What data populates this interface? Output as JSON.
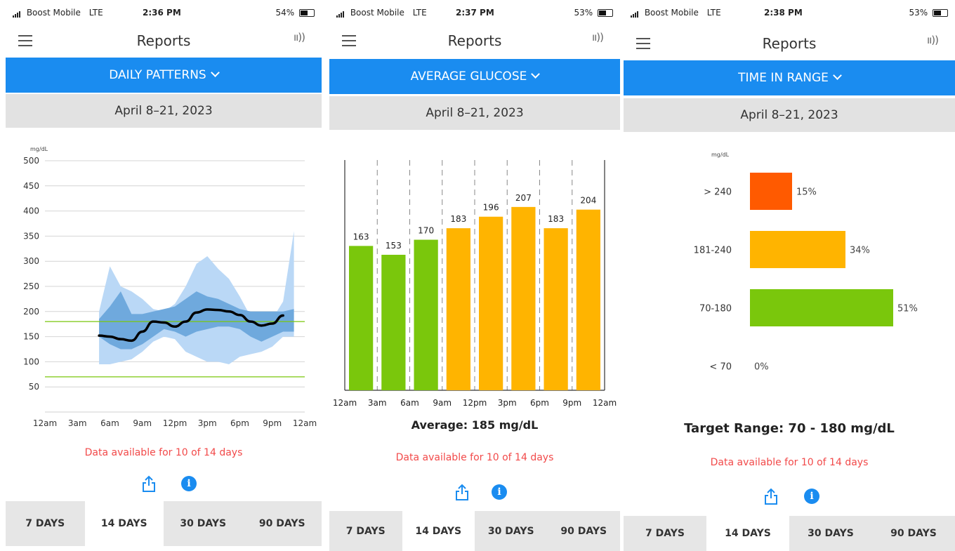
{
  "colors": {
    "accent": "#1a8cf0",
    "warning_text": "#f24a4a",
    "green": "#7ac70c",
    "orange": "#ffb400",
    "red": "#ff5a00"
  },
  "panels": [
    {
      "status": {
        "carrier": "Boost Mobile",
        "network": "LTE",
        "time": "2:36 PM",
        "battery": "54%"
      },
      "title": "Reports",
      "report_type": "DAILY PATTERNS",
      "date_range": "April 8–21, 2023",
      "note": "Data available for 10 of 14 days",
      "tabs": [
        "7 DAYS",
        "14 DAYS",
        "30 DAYS",
        "90 DAYS"
      ],
      "active_tab": 1
    },
    {
      "status": {
        "carrier": "Boost Mobile",
        "network": "LTE",
        "time": "2:37 PM",
        "battery": "53%"
      },
      "title": "Reports",
      "report_type": "AVERAGE GLUCOSE",
      "date_range": "April 8–21, 2023",
      "average": "Average: 185 mg/dL",
      "note": "Data available for 10 of 14 days",
      "tabs": [
        "7 DAYS",
        "14 DAYS",
        "30 DAYS",
        "90 DAYS"
      ],
      "active_tab": 1
    },
    {
      "status": {
        "carrier": "Boost Mobile",
        "network": "LTE",
        "time": "2:38 PM",
        "battery": "53%"
      },
      "title": "Reports",
      "report_type": "TIME IN RANGE",
      "date_range": "April 8–21, 2023",
      "target": "Target Range: 70 - 180 mg/dL",
      "note": "Data available for 10 of 14 days",
      "tabs": [
        "7 DAYS",
        "14 DAYS",
        "30 DAYS",
        "90 DAYS"
      ],
      "active_tab": 1
    }
  ],
  "chart_data": [
    {
      "type": "area",
      "ylabel": "mg/dL",
      "ylim": [
        0,
        500
      ],
      "yticks": [
        50,
        100,
        150,
        200,
        250,
        300,
        350,
        400,
        450,
        500
      ],
      "xticks": [
        "12am",
        "3am",
        "6am",
        "9am",
        "12pm",
        "3pm",
        "6pm",
        "9pm",
        "12am"
      ],
      "target_lines": [
        70,
        180
      ],
      "x_hours": [
        5,
        6,
        7,
        8,
        9,
        10,
        11,
        12,
        13,
        14,
        15,
        16,
        17,
        18,
        19,
        20,
        21,
        22,
        23
      ],
      "series": [
        {
          "name": "",
          "role": "band_outer_upper",
          "values": [
            200,
            290,
            250,
            240,
            225,
            205,
            200,
            215,
            250,
            295,
            310,
            285,
            265,
            230,
            190,
            180,
            185,
            220,
            360
          ]
        },
        {
          "name": "",
          "role": "band_inner_upper",
          "values": [
            185,
            210,
            240,
            195,
            195,
            200,
            205,
            210,
            225,
            240,
            230,
            225,
            215,
            205,
            200,
            200,
            200,
            200,
            205
          ]
        },
        {
          "name": "",
          "role": "median",
          "values": [
            152,
            150,
            145,
            142,
            160,
            180,
            178,
            170,
            180,
            198,
            204,
            203,
            200,
            193,
            180,
            172,
            176,
            192,
            null
          ]
        },
        {
          "name": "",
          "role": "band_inner_lower",
          "values": [
            150,
            135,
            125,
            125,
            135,
            150,
            165,
            160,
            150,
            160,
            165,
            170,
            170,
            165,
            150,
            140,
            150,
            160,
            null
          ]
        },
        {
          "name": "",
          "role": "band_outer_lower",
          "values": [
            95,
            95,
            100,
            105,
            120,
            140,
            150,
            145,
            120,
            110,
            100,
            100,
            95,
            110,
            115,
            120,
            130,
            150,
            null
          ]
        }
      ],
      "band_colors": {
        "outer": "#bad8f6",
        "inner": "#6fa9dd",
        "median": "#000000",
        "target": "#7ac70c"
      }
    },
    {
      "type": "bar",
      "categories": [
        "12am",
        "3am",
        "6am",
        "9am",
        "12pm",
        "3pm",
        "6pm",
        "9pm"
      ],
      "xticks": [
        "12am",
        "3am",
        "6am",
        "9am",
        "12pm",
        "3pm",
        "6pm",
        "9pm",
        "12am"
      ],
      "values": [
        163,
        153,
        170,
        183,
        196,
        207,
        183,
        204
      ],
      "bar_colors": [
        "#7ac70c",
        "#7ac70c",
        "#7ac70c",
        "#ffb400",
        "#ffb400",
        "#ffb400",
        "#ffb400",
        "#ffb400"
      ],
      "ylim": [
        0,
        260
      ]
    },
    {
      "type": "bar",
      "orientation": "horizontal",
      "ylabel": "mg/dL",
      "categories": [
        "> 240",
        "181-240",
        "70-180",
        "< 70"
      ],
      "values": [
        15,
        34,
        51,
        0
      ],
      "value_labels": [
        "15%",
        "34%",
        "51%",
        "0%"
      ],
      "bar_colors": [
        "#ff5a00",
        "#ffb400",
        "#7ac70c",
        "#f24a4a"
      ]
    }
  ]
}
